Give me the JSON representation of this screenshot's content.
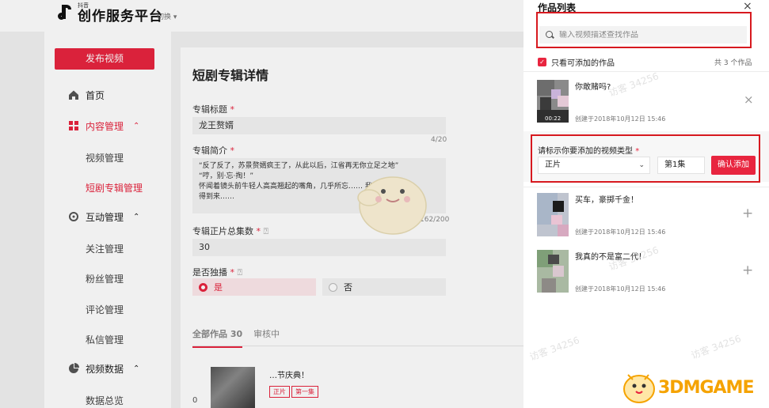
{
  "app": {
    "logo_small": "抖音",
    "logo_big": "创作服务平台",
    "switch_label": "切换 ▾"
  },
  "sidebar": {
    "publish_button": "发布视频",
    "items": [
      {
        "label": "首页",
        "icon": "home-icon"
      },
      {
        "label": "内容管理",
        "icon": "grid-icon",
        "chevron": "⌃"
      },
      {
        "label": "视频管理"
      },
      {
        "label": "短剧专辑管理"
      },
      {
        "label": "互动管理",
        "icon": "interaction-icon",
        "chevron": "⌃"
      },
      {
        "label": "关注管理"
      },
      {
        "label": "粉丝管理"
      },
      {
        "label": "评论管理"
      },
      {
        "label": "私信管理"
      },
      {
        "label": "视频数据",
        "icon": "pie-chart-icon",
        "chevron": "⌃"
      },
      {
        "label": "数据总览"
      }
    ]
  },
  "main": {
    "title": "短剧专辑详情",
    "album_title_label": "专辑标题",
    "album_title_value": "龙王赘婿",
    "title_counter": "4/20",
    "intro_label": "专辑简介",
    "intro_line1": "“反了反了，苏景赘婿疯王了，从此以后，江省再无你立足之地”",
    "intro_line2": "“哼，别·忘·掏！”",
    "intro_line3": "怀闻着镜头前牛轻人高高翘起的嘴角，几乎所忘……  我……  回",
    "intro_line4": "得到来……",
    "intro_counter": "162/200",
    "episodes_label": "专辑正片总集数",
    "episodes_value": "30",
    "exclusive_label": "是否独播",
    "yes": "是",
    "no": "否",
    "tab_all": "全部作品 30",
    "tab_review": "审核中",
    "work_title": "…节庆典！",
    "work_tag1": "正片",
    "work_tag2": "第一集",
    "zero": "0"
  },
  "drawer": {
    "title": "作品列表",
    "close": "×",
    "search_placeholder": "输入视频描述查找作品",
    "filter_label": "只看可添加的作品",
    "filter_checked": "✓",
    "total": "共 3 个作品",
    "items": [
      {
        "title": "你敢赌吗?",
        "date": "创建于2018年10月12日 15:46",
        "duration": "00:22",
        "action": "×"
      },
      {
        "title": "买车，豪掷千金！",
        "date": "创建于2018年10月12日 15:46",
        "action": "+"
      },
      {
        "title": "我真的不是富二代！",
        "date": "创建于2018年10月12日 15:46",
        "action": "+"
      }
    ],
    "type_label": "请标示你要添加的视频类型",
    "type_value": "正片",
    "episode_value": "第1集",
    "confirm_button": "确认添加",
    "watermark": "访客 34256"
  },
  "brand": "3DMGAME",
  "colors": {
    "accent": "#e8253f",
    "highlight_box": "#d7191f",
    "brand": "#f5a300"
  }
}
